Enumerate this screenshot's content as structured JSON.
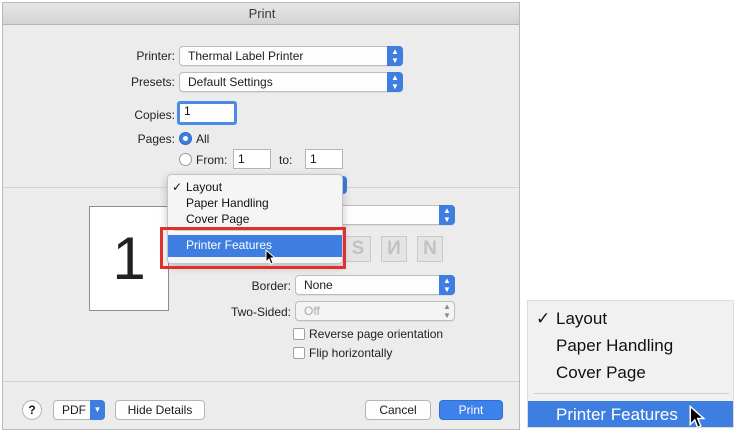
{
  "window": {
    "title": "Print"
  },
  "printer": {
    "label": "Printer:",
    "value": "Thermal Label Printer"
  },
  "presets": {
    "label": "Presets:",
    "value": "Default Settings"
  },
  "copies": {
    "label": "Copies:",
    "value": "1"
  },
  "pages": {
    "label": "Pages:",
    "all_label": "All",
    "from_label": "From:",
    "from_value": "1",
    "to_label": "to:",
    "to_value": "1"
  },
  "preview": {
    "page_number": "1"
  },
  "section_menu": {
    "checkmark": "✓",
    "items": [
      "Layout",
      "Paper Handling",
      "Cover Page",
      "Printer Features"
    ],
    "checked_index": 0,
    "highlighted_index": 3
  },
  "layout_orientation": [
    "S",
    "И",
    "N"
  ],
  "border": {
    "label": "Border:",
    "value": "None"
  },
  "two_sided": {
    "label": "Two-Sided:",
    "value": "Off"
  },
  "options": {
    "reverse_label": "Reverse page orientation",
    "flip_label": "Flip horizontally"
  },
  "footer": {
    "help_label": "?",
    "pdf_label": "PDF",
    "hide_details_label": "Hide Details",
    "cancel_label": "Cancel",
    "print_label": "Print"
  },
  "zoom_inset": {
    "checkmark": "✓",
    "items": [
      "Layout",
      "Paper Handling",
      "Cover Page",
      "Printer Features"
    ]
  },
  "colors": {
    "accent": "#3d7ee0",
    "highlight_border": "#e0302b",
    "dialog_bg": "#ececec"
  }
}
